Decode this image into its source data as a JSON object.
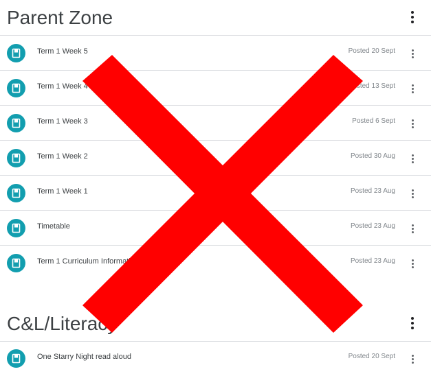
{
  "sections": [
    {
      "title": "Parent Zone",
      "items": [
        {
          "title": "Term 1 Week 5",
          "date": "Posted 20 Sept"
        },
        {
          "title": "Term 1 Week 4",
          "date": "Posted 13 Sept"
        },
        {
          "title": "Term 1 Week 3",
          "date": "Posted 6 Sept"
        },
        {
          "title": "Term 1 Week 2",
          "date": "Posted 30 Aug"
        },
        {
          "title": "Term 1 Week 1",
          "date": "Posted 23 Aug"
        },
        {
          "title": "Timetable",
          "date": "Posted 23 Aug"
        },
        {
          "title": "Term 1 Curriculum Information",
          "date": "Posted 23 Aug"
        }
      ]
    },
    {
      "title": "C&L/Literacy",
      "items": [
        {
          "title": "One Starry Night read aloud",
          "date": "Posted 20 Sept"
        }
      ]
    }
  ],
  "icons": {
    "item": "material-book-icon",
    "menu": "more-vert-icon",
    "overlay": "red-x-mark"
  },
  "colors": {
    "icon_bg": "#129eaf",
    "overlay": "#ff0000",
    "divider": "#dadce0"
  }
}
